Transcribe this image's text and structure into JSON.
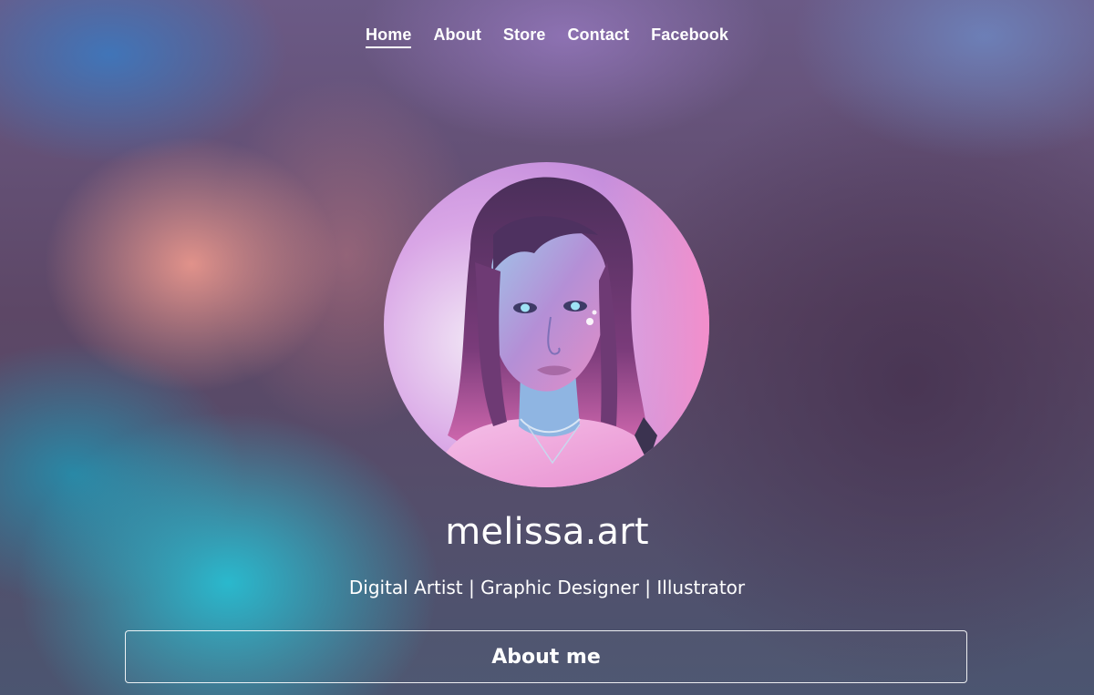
{
  "nav": {
    "items": [
      {
        "label": "Home",
        "active": true
      },
      {
        "label": "About",
        "active": false
      },
      {
        "label": "Store",
        "active": false
      },
      {
        "label": "Contact",
        "active": false
      },
      {
        "label": "Facebook",
        "active": false
      }
    ]
  },
  "profile": {
    "name": "melissa.art",
    "tagline": "Digital Artist | Graphic Designer | Illustrator",
    "avatar_icon": "profile-photo"
  },
  "buttons": {
    "about_label": "About me"
  },
  "colors": {
    "text": "#ffffff",
    "accent_pink": "#e896b4",
    "accent_teal": "#28bed2"
  }
}
